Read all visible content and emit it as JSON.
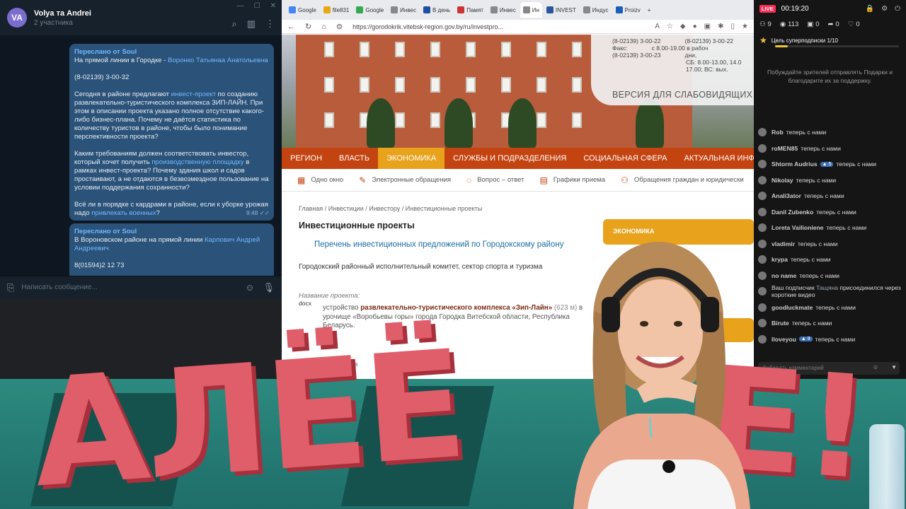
{
  "telegram": {
    "avatar_initials": "VA",
    "chat_name": "Volya та Andrei",
    "members": "2 участника",
    "messages": [
      {
        "forwarded": "Переслано от Soul",
        "line1_pre": "На прямой линии в Городке - ",
        "line1_link": "Воронко Татьянаа Анатольевна",
        "phone": "(8-02139) 3-00-32",
        "p2_pre": "Сегодня в районе предлагают ",
        "p2_link": "инвест-проект",
        "p2_post": " по созданию развлекательно-туристического комплекса ЗИП-ЛАЙН. При этом в описании проекта указано полное отсутствие какого-либо бизнес-плана. Почему не даётся статистика по количеству туристов в районе, чтобы было понимание перспективности проекта?",
        "p3_pre": "Каким требованиям должен соответствовать инвестор, который хочет получить ",
        "p3_link": "производственную площадку",
        "p3_post": " в рамках инвест-проекта? Почему здания школ и садов простаивают, а не отдаются в безвозмездное пользование на условии поддержания сохранности?",
        "p4_pre": "Всё ли в порядке с кардрами в районе, если к уборке урожая надо ",
        "p4_link": "привлекать военных",
        "p4_post": "?",
        "time": "9:48"
      },
      {
        "forwarded": "Переслано от Soul",
        "line1_pre": "В Вороновском районе на прямой линии ",
        "line1_link": "Карпович Андрей Андреевич",
        "phone": "8(01594)2 12 73"
      }
    ],
    "input_placeholder": "Написать сообщение..."
  },
  "browser": {
    "tabs": [
      "Google",
      "file831",
      "Google",
      "Инвес",
      "В день",
      "Памят",
      "Инвес",
      "Ин",
      "INVEST",
      "Индус",
      "Proizv"
    ],
    "active_tab_index": 7,
    "url": "https://gorodokrik.vitebsk-region.gov.by/ru/investpro...",
    "contact": {
      "phone_a": "(8-02139) 3-00-22",
      "fax_label": "Факс:",
      "fax": "(8-02139) 3-00-23",
      "phone_b": "(8-02139) 3-00-22",
      "hours_1": "с 8.00-19.00 в рабоч",
      "hours_2": "дни,",
      "hours_3": "СБ: 8.00-13.00, 14.0",
      "hours_4": "17.00; ВС: вых."
    },
    "vision_button": "ВЕРСИЯ ДЛЯ СЛАБОВИДЯЩИХ",
    "main_nav": [
      "РЕГИОН",
      "ВЛАСТЬ",
      "ЭКОНОМИКА",
      "СЛУЖБЫ И ПОДРАЗДЕЛЕНИЯ",
      "СОЦИАЛЬНАЯ СФЕРА",
      "АКТУАЛЬНАЯ ИНФОРМ"
    ],
    "main_nav_active": 2,
    "sub_nav": [
      "Одно окно",
      "Электронные обращения",
      "Вопрос – ответ",
      "Графики приема",
      "Обращения граждан и юридически"
    ],
    "breadcrumbs": "Главная / Инвестиции / Инвестору / Инвестиционные проекты",
    "page_title": "Инвестиционные проекты",
    "list_link": "Перечень инвестиционных предложений по Городокскому району",
    "organization": "Городокский районный исполнительный комитет, сектор спорта и туризма",
    "project_label": "Название проекта:",
    "docx": "docx",
    "project_pre": "устройство ",
    "project_bold": "развлекательно-туристического комплекса «Зип-Лайн»",
    "project_dim": " (623 м)",
    "project_post": " в урочище «Воробьевы горы» города Городка Витебской области, Республика Беларусь.",
    "project_label2": "Название проекта",
    "sidebar_button": "ЭКОНОМИКА"
  },
  "stream": {
    "live": "LIVE",
    "timer": "00:19:20",
    "stats": [
      {
        "icon": "viewers-icon",
        "value": "9"
      },
      {
        "icon": "eye-icon",
        "value": "113"
      },
      {
        "icon": "gift-icon",
        "value": "0"
      },
      {
        "icon": "share-icon",
        "value": "0"
      },
      {
        "icon": "heart-icon",
        "value": "0"
      }
    ],
    "goal_text": "Цель суперподписки",
    "goal_count": "1/10",
    "goal_progress": 0.1,
    "hint": "Побуждайте зрителей отправлять Подарки и благодарите их за поддержку.",
    "feed": [
      {
        "user": "Rob",
        "text": "теперь с нами"
      },
      {
        "user": "roMEN85",
        "text": "теперь с нами"
      },
      {
        "user": "Shtorm Audrius",
        "badge": "5",
        "text": "теперь с нами"
      },
      {
        "user": "Nikolay",
        "text": "теперь с нами"
      },
      {
        "user": "Anali3ator",
        "text": "теперь с нами"
      },
      {
        "user": "Danil Zubenko",
        "text": "теперь с нами"
      },
      {
        "user": "Loreta Vailioniene",
        "text": "теперь с нами"
      },
      {
        "user": "vladimir",
        "text": "теперь с нами"
      },
      {
        "user": "kryра",
        "text": "теперь с нами"
      },
      {
        "user": "no name",
        "text": "теперь с нами"
      },
      {
        "vip_pre": "Ваш подписчик ",
        "vip_name": "Тащяна",
        "vip_post": " присоединился через короткие видео"
      },
      {
        "user": "goodluckmate",
        "text": "теперь с нами"
      },
      {
        "user": "Birute",
        "text": "теперь с нами"
      },
      {
        "user": "lloveyou",
        "badge": "9",
        "text": "теперь с нами"
      }
    ],
    "comment_placeholder": "Добавить комментарий"
  },
  "banner": {
    "text_left": "АЛЁЁ",
    "text_right": "Е!"
  },
  "colors": {
    "site_red": "#c44411",
    "site_orange": "#e8a21b",
    "tg_bubble": "#2b5278",
    "banner_teal": "#2d8a7f",
    "banner_letters": "#e05d6a"
  }
}
